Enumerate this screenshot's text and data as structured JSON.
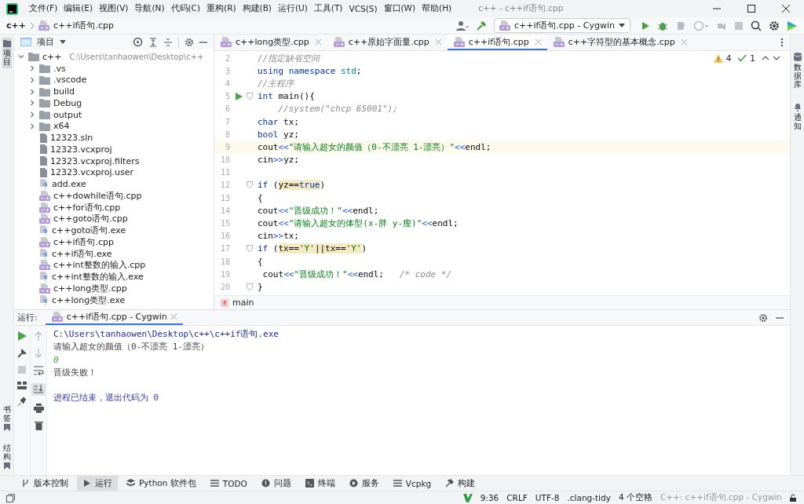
{
  "window": {
    "title": "c++ - c++if语句.cpp",
    "menus": [
      "文件(F)",
      "编辑(E)",
      "视图(V)",
      "导航(N)",
      "代码(C)",
      "重构(R)",
      "构建(B)",
      "运行(U)",
      "工具(T)",
      "VCS(S)",
      "窗口(W)",
      "帮助(H)"
    ]
  },
  "navbar": {
    "breadcrumbs": [
      "c++",
      "c++if语句.cpp"
    ],
    "run_config": "c++if语句.cpp - Cygwin"
  },
  "left_stripe": {
    "top": [
      {
        "label": "项目",
        "selected": true
      }
    ],
    "bottom": [
      {
        "label": "书签",
        "selected": false
      },
      {
        "label": "结构",
        "selected": false
      }
    ]
  },
  "right_stripe": [
    {
      "label": "数据库",
      "kind": "database"
    },
    {
      "label": "通知",
      "kind": "bell"
    }
  ],
  "project": {
    "title": "项目",
    "tree": [
      {
        "name": "c++",
        "path": "C:\\Users\\tanhaowen\\Desktop\\c++",
        "kind": "folder",
        "expanded": true,
        "children": [
          {
            "name": ".vs",
            "kind": "folder",
            "expanded": false
          },
          {
            "name": ".vscode",
            "kind": "folder",
            "expanded": false
          },
          {
            "name": "build",
            "kind": "folder",
            "expanded": false
          },
          {
            "name": "Debug",
            "kind": "folder",
            "expanded": false
          },
          {
            "name": "output",
            "kind": "folder",
            "expanded": false
          },
          {
            "name": "x64",
            "kind": "folder",
            "expanded": false
          },
          {
            "name": "12323.sln",
            "kind": "file"
          },
          {
            "name": "12323.vcxproj",
            "kind": "file"
          },
          {
            "name": "12323.vcxproj.filters",
            "kind": "file"
          },
          {
            "name": "12323.vcxproj.user",
            "kind": "file"
          },
          {
            "name": "add.exe",
            "kind": "exe"
          },
          {
            "name": "c++dowhile语句.cpp",
            "kind": "cpp"
          },
          {
            "name": "c++for语句.cpp",
            "kind": "cpp"
          },
          {
            "name": "c++goto语句.cpp",
            "kind": "cpp"
          },
          {
            "name": "c++goto语句.exe",
            "kind": "exe"
          },
          {
            "name": "c++if语句.cpp",
            "kind": "cpp"
          },
          {
            "name": "c++if语句.exe",
            "kind": "exe"
          },
          {
            "name": "c++int整数的输入.cpp",
            "kind": "cpp"
          },
          {
            "name": "c++int整数的输入.exe",
            "kind": "exe"
          },
          {
            "name": "c++long类型.cpp",
            "kind": "cpp"
          },
          {
            "name": "c++long类型.exe",
            "kind": "exe"
          }
        ]
      }
    ]
  },
  "editor": {
    "tabs": [
      {
        "label": "c++long类型.cpp",
        "selected": false
      },
      {
        "label": "c++原始字面量.cpp",
        "selected": false
      },
      {
        "label": "c++if语句.cpp",
        "selected": true
      },
      {
        "label": "c++字符型的基本概念.cpp",
        "selected": false
      }
    ],
    "warnings": "4",
    "checks": "1",
    "lines": [
      {
        "no": "2",
        "tokens": [
          {
            "t": "//指定缺省空间",
            "kind": "comment"
          }
        ]
      },
      {
        "no": "3",
        "tokens": [
          {
            "t": "using namespace",
            "kind": "keyword"
          },
          {
            "t": " std",
            "kind": "ns"
          },
          {
            "t": ";"
          }
        ]
      },
      {
        "no": "4",
        "tokens": [
          {
            "t": "//主程序",
            "kind": "comment"
          }
        ]
      },
      {
        "no": "5",
        "run": true,
        "fold": true,
        "tokens": [
          {
            "t": "int",
            "kind": "keyword"
          },
          {
            "t": " main(){"
          }
        ]
      },
      {
        "no": "6",
        "tokens": [
          {
            "t": "    //system(\"chcp 65001\");",
            "kind": "comment"
          }
        ]
      },
      {
        "no": "7",
        "tokens": [
          {
            "t": "char",
            "kind": "keyword"
          },
          {
            "t": " tx;"
          }
        ]
      },
      {
        "no": "8",
        "tokens": [
          {
            "t": "bool",
            "kind": "keyword"
          },
          {
            "t": " yz;"
          }
        ]
      },
      {
        "no": "9",
        "current": true,
        "tokens": [
          {
            "t": "cout"
          },
          {
            "t": "<<",
            "kind": "op"
          },
          {
            "t": "\"请输入超女的颜值（0-不漂亮 1-漂亮）\"",
            "kind": "string"
          },
          {
            "t": "<<",
            "kind": "op"
          },
          {
            "t": "endl;"
          }
        ]
      },
      {
        "no": "10",
        "tokens": [
          {
            "t": "cin"
          },
          {
            "t": ">>",
            "kind": "op"
          },
          {
            "t": "yz;"
          }
        ]
      },
      {
        "no": "11"
      },
      {
        "no": "12",
        "fold": true,
        "tokens": [
          {
            "t": "if",
            "kind": "keyword"
          },
          {
            "t": " ("
          },
          {
            "t": "yz==",
            "hl": true
          },
          {
            "t": "true",
            "kind": "keyword",
            "hl": true
          },
          {
            "t": ")"
          }
        ]
      },
      {
        "no": "13",
        "tokens": [
          {
            "t": "{"
          }
        ]
      },
      {
        "no": "14",
        "tokens": [
          {
            "t": "cout"
          },
          {
            "t": "<<",
            "kind": "op"
          },
          {
            "t": "\"晋级成功！\"",
            "kind": "string"
          },
          {
            "t": "<<",
            "kind": "op"
          },
          {
            "t": "endl;"
          }
        ]
      },
      {
        "no": "15",
        "tokens": [
          {
            "t": "cout"
          },
          {
            "t": "<<",
            "kind": "op"
          },
          {
            "t": "\"请输入超女的体型(x-胖 y-瘦)\"",
            "kind": "string"
          },
          {
            "t": "<<",
            "kind": "op"
          },
          {
            "t": "endl;"
          }
        ]
      },
      {
        "no": "16",
        "tokens": [
          {
            "t": "cin"
          },
          {
            "t": ">>",
            "kind": "op"
          },
          {
            "t": "tx;"
          }
        ]
      },
      {
        "no": "17",
        "fold": true,
        "tokens": [
          {
            "t": "if",
            "kind": "keyword"
          },
          {
            "t": " ("
          },
          {
            "t": "tx==",
            "hl": true
          },
          {
            "t": "'Y'",
            "kind": "string",
            "hl": true
          },
          {
            "t": "||tx==",
            "hl": true
          },
          {
            "t": "'Y'",
            "kind": "string",
            "hl": true
          },
          {
            "t": ")"
          }
        ]
      },
      {
        "no": "18",
        "tokens": [
          {
            "t": "{"
          }
        ]
      },
      {
        "no": "19",
        "tokens": [
          {
            "t": " cout"
          },
          {
            "t": "<<",
            "kind": "op"
          },
          {
            "t": "\"晋级成功！\"",
            "kind": "string"
          },
          {
            "t": "<<",
            "kind": "op"
          },
          {
            "t": "endl;   "
          },
          {
            "t": "/* code */",
            "kind": "comment"
          }
        ]
      },
      {
        "no": "20",
        "fold": true,
        "tokens": [
          {
            "t": "}"
          }
        ]
      }
    ],
    "breadcrumb": "main"
  },
  "run": {
    "label": "运行:",
    "tab": "c++if语句.cpp - Cygwin",
    "output": [
      {
        "text": "C:\\Users\\tanhaowen\\Desktop\\c++\\c++if语句.exe",
        "kind": "command"
      },
      {
        "text": "请输入超女的颜值（0-不漂亮 1-漂亮）",
        "kind": "stdout"
      },
      {
        "text": "0",
        "kind": "input"
      },
      {
        "text": "晋级失败！",
        "kind": "stdout"
      },
      {
        "kind": "blank"
      },
      {
        "text": "进程已结束，退出代码为 0",
        "kind": "exit"
      }
    ]
  },
  "tool_windows": [
    {
      "label": "版本控制",
      "kind": "vcs",
      "selected": false
    },
    {
      "label": "运行",
      "kind": "run",
      "selected": true
    },
    {
      "label": "Python 软件包",
      "kind": "python",
      "selected": false
    },
    {
      "label": "TODO",
      "kind": "list",
      "selected": false
    },
    {
      "label": "问题",
      "kind": "problems",
      "selected": false
    },
    {
      "label": "终端",
      "kind": "terminal",
      "selected": false
    },
    {
      "label": "服务",
      "kind": "services",
      "selected": false
    },
    {
      "label": "Vcpkg",
      "kind": "list",
      "selected": false
    },
    {
      "label": "构建",
      "kind": "build",
      "selected": false
    }
  ],
  "status_bar": {
    "position": "9:36",
    "line_sep": "CRLF",
    "encoding": "UTF-8",
    "inspection": ".clang-tidy",
    "indent": "4 个空格",
    "context": "C++: c++if语句.cpp - Cygwin"
  }
}
